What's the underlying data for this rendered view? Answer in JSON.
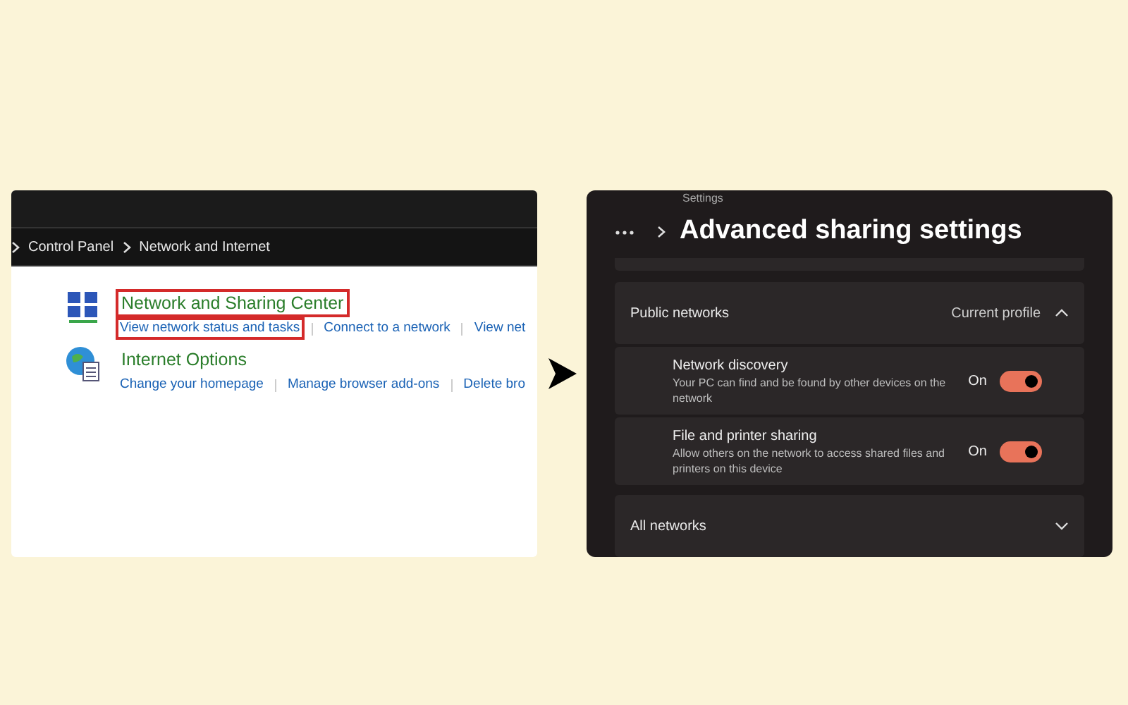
{
  "control_panel": {
    "breadcrumb": [
      "Control Panel",
      "Network and Internet"
    ],
    "categories": [
      {
        "kind": "network",
        "title": "Network and Sharing Center",
        "highlighted": true,
        "links": [
          {
            "label": "View network status and tasks",
            "highlighted": true
          },
          {
            "label": "Connect to a network",
            "highlighted": false
          },
          {
            "label": "View net",
            "highlighted": false
          }
        ]
      },
      {
        "kind": "internet",
        "title": "Internet Options",
        "highlighted": false,
        "links": [
          {
            "label": "Change your homepage",
            "highlighted": false
          },
          {
            "label": "Manage browser add-ons",
            "highlighted": false
          },
          {
            "label": "Delete bro",
            "highlighted": false
          }
        ]
      }
    ]
  },
  "settings": {
    "app_title": "Settings",
    "page_title": "Advanced sharing settings",
    "sections": [
      {
        "title": "Public networks",
        "note": "Current profile",
        "expanded": true,
        "items": [
          {
            "title": "Network discovery",
            "description": "Your PC can find and be found by other devices on the network",
            "state_label": "On",
            "on": true
          },
          {
            "title": "File and printer sharing",
            "description": "Allow others on the network to access shared files and printers on this device",
            "state_label": "On",
            "on": true
          }
        ]
      },
      {
        "title": "All networks",
        "expanded": false
      }
    ]
  }
}
